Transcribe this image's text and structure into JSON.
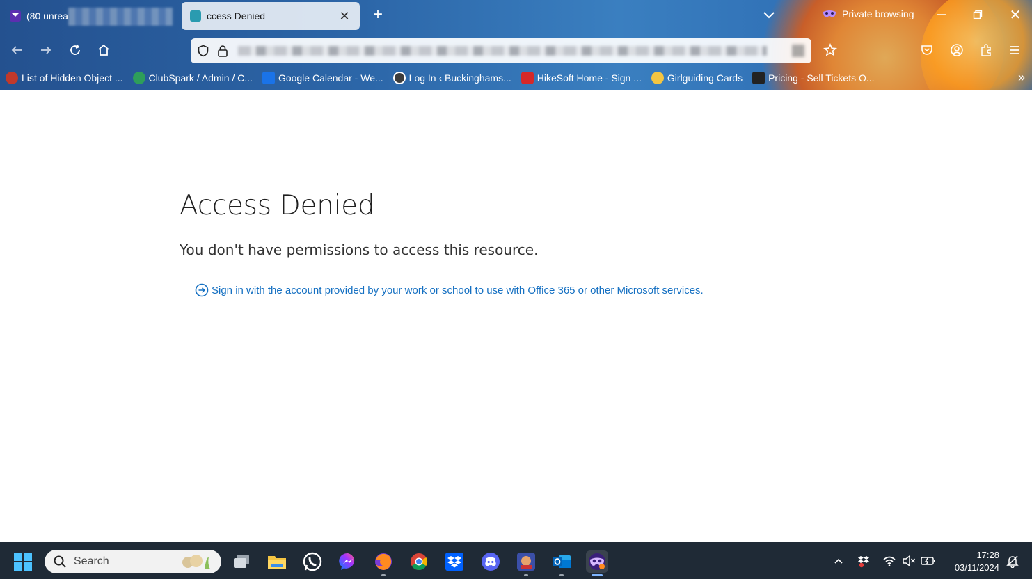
{
  "browser": {
    "tabs": [
      {
        "title": "(80 unrea",
        "state": "inactive",
        "favicon": "mail-icon"
      },
      {
        "title": "ccess Denied",
        "state": "active",
        "favicon": "site-icon"
      }
    ],
    "new_tab_symbol": "+",
    "private_label": "Private browsing",
    "close_tab_symbol": "✕",
    "window_close_symbol": "✕",
    "bookmarks": [
      {
        "label": "List of Hidden Object ...",
        "icon": "hidden-object-icon",
        "color": "#c0392b"
      },
      {
        "label": "ClubSpark / Admin / C...",
        "icon": "clubspark-icon",
        "color": "#2e9e5a"
      },
      {
        "label": "Google Calendar - We...",
        "icon": "google-calendar-icon",
        "color": "#1a73e8"
      },
      {
        "label": "Log In ‹ Buckinghams...",
        "icon": "wordpress-icon",
        "color": "#3c3c3c"
      },
      {
        "label": "HikeSoft Home - Sign ...",
        "icon": "hikesoft-icon",
        "color": "#d62828"
      },
      {
        "label": "Girlguiding Cards",
        "icon": "lightbulb-icon",
        "color": "#f4c542"
      },
      {
        "label": "Pricing - Sell Tickets O...",
        "icon": "ticket-icon",
        "color": "#222222"
      }
    ],
    "bookmarks_overflow": "»"
  },
  "page": {
    "heading": "Access Denied",
    "message": "You don't have permissions to access this resource.",
    "signin_link": "Sign in with the account provided by your work or school to use with Office 365 or other Microsoft services.",
    "link_color": "#1570c2"
  },
  "taskbar": {
    "search_label": "Search",
    "apps": [
      "task-view-icon",
      "file-explorer-icon",
      "whatsapp-icon",
      "messenger-icon",
      "firefox-icon",
      "chrome-icon",
      "dropbox-icon",
      "discord-icon",
      "game-icon",
      "outlook-icon",
      "firefox-private-icon"
    ],
    "time": "17:28",
    "date": "03/11/2024"
  }
}
